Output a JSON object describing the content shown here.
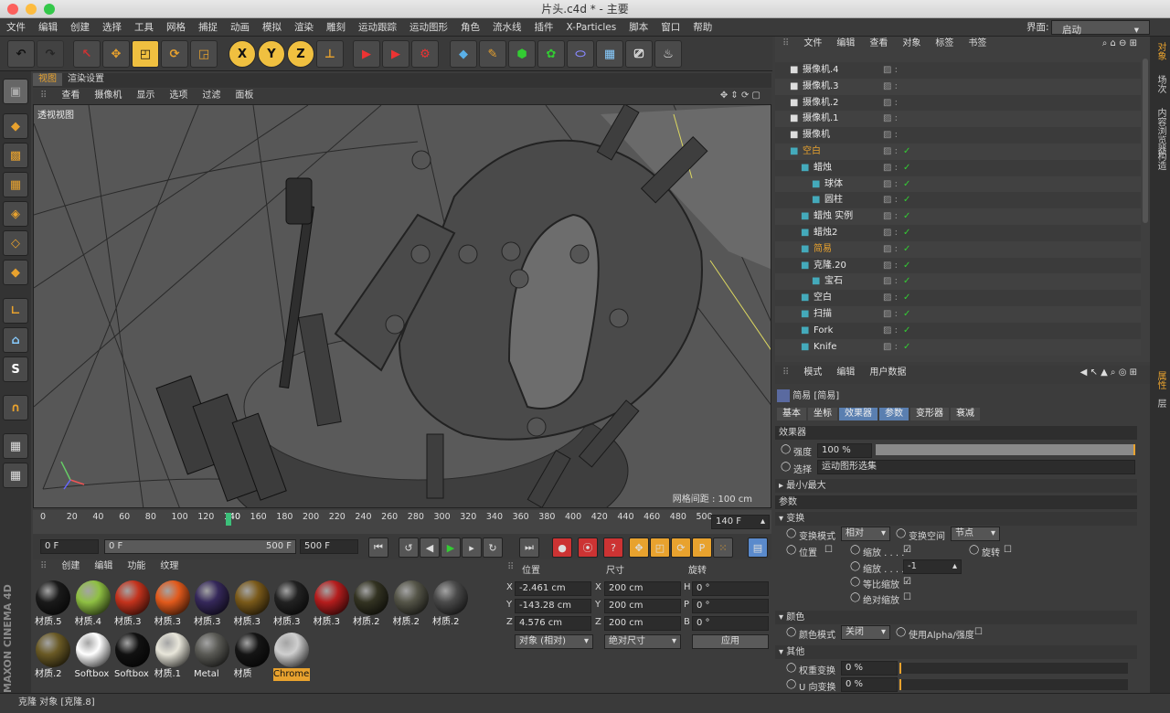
{
  "window": {
    "title": "片头.c4d * - 主要"
  },
  "menu": [
    "文件",
    "编辑",
    "创建",
    "选择",
    "工具",
    "网格",
    "捕捉",
    "动画",
    "模拟",
    "渲染",
    "雕刻",
    "运动跟踪",
    "运动图形",
    "角色",
    "流水线",
    "插件",
    "X-Particles",
    "脚本",
    "窗口",
    "帮助"
  ],
  "layout": {
    "label": "界面:",
    "value": "启动"
  },
  "toolbar": {
    "x": "X",
    "y": "Y",
    "z": "Z"
  },
  "viewport": {
    "tabs": [
      "视图",
      "渲染设置"
    ],
    "menu": [
      "查看",
      "摄像机",
      "显示",
      "选项",
      "过滤",
      "面板"
    ],
    "label": "透视视图",
    "grid": "网格间距 : 100 cm"
  },
  "timeline": {
    "ticks": [
      "0",
      "20",
      "40",
      "60",
      "80",
      "100",
      "120",
      "140",
      "160",
      "180",
      "200",
      "220",
      "240",
      "260",
      "280",
      "300",
      "320",
      "340",
      "360",
      "380",
      "400",
      "420",
      "440",
      "460",
      "480",
      "500"
    ],
    "current": "140",
    "frame_field": "140 F"
  },
  "playback": {
    "start": "0 F",
    "range_start": "0 F",
    "range_end": "500 F",
    "end": "500 F"
  },
  "materials": {
    "menu": [
      "创建",
      "编辑",
      "功能",
      "纹理"
    ],
    "items": [
      {
        "name": "材质.5",
        "color": "#1a1a1a"
      },
      {
        "name": "材质.4",
        "color": "#8fc043"
      },
      {
        "name": "材质.3",
        "color": "#c4331d"
      },
      {
        "name": "材质.3",
        "color": "#e25a1c"
      },
      {
        "name": "材质.3",
        "color": "#35285a"
      },
      {
        "name": "材质.3",
        "color": "#7a5a1a"
      },
      {
        "name": "材质.3",
        "color": "#222222"
      },
      {
        "name": "材质.3",
        "color": "#b51d1d"
      },
      {
        "name": "材质.2",
        "color": "#333322"
      },
      {
        "name": "材质.2",
        "color": "#555548"
      },
      {
        "name": "材质.2",
        "color": "#4a4a4a"
      },
      {
        "name": "材质.2",
        "color": "#6a5a25"
      },
      {
        "name": "Softbox",
        "color": "#ffffff"
      },
      {
        "name": "Softbox",
        "color": "#111111"
      },
      {
        "name": "材质.1",
        "color": "#e8e6da"
      },
      {
        "name": "Metal",
        "color": "#5a5a55"
      },
      {
        "name": "材质",
        "color": "#151515"
      },
      {
        "name": "Chrome",
        "color": "#cfcfcf"
      }
    ]
  },
  "coords": {
    "headers": [
      "位置",
      "尺寸",
      "旋转"
    ],
    "rows": [
      {
        "axis": "X",
        "pos": "-2.461 cm",
        "size_axis": "X",
        "size": "200 cm",
        "rot_axis": "H",
        "rot": "0 °"
      },
      {
        "axis": "Y",
        "pos": "-143.28 cm",
        "size_axis": "Y",
        "size": "200 cm",
        "rot_axis": "P",
        "rot": "0 °"
      },
      {
        "axis": "Z",
        "pos": "4.576 cm",
        "size_axis": "Z",
        "size": "200 cm",
        "rot_axis": "B",
        "rot": "0 °"
      }
    ],
    "mode": "对象 (相对)",
    "size_mode": "绝对尺寸",
    "apply": "应用"
  },
  "objects": {
    "menu": [
      "文件",
      "编辑",
      "查看",
      "对象",
      "标签",
      "书签"
    ],
    "rows": [
      {
        "name": "摄像机.4",
        "indent": 0
      },
      {
        "name": "摄像机.3",
        "indent": 0
      },
      {
        "name": "摄像机.2",
        "indent": 0
      },
      {
        "name": "摄像机.1",
        "indent": 0
      },
      {
        "name": "摄像机",
        "indent": 0
      },
      {
        "name": "空白",
        "indent": 0
      },
      {
        "name": "蜡烛",
        "indent": 1
      },
      {
        "name": "球体",
        "indent": 2
      },
      {
        "name": "圆柱",
        "indent": 2
      },
      {
        "name": "蜡烛 实例",
        "indent": 1
      },
      {
        "name": "蜡烛2",
        "indent": 1
      },
      {
        "name": "简易",
        "indent": 1
      },
      {
        "name": "克隆.20",
        "indent": 1
      },
      {
        "name": "宝石",
        "indent": 2
      },
      {
        "name": "空白",
        "indent": 1
      },
      {
        "name": "扫描",
        "indent": 1
      },
      {
        "name": "Fork",
        "indent": 1
      },
      {
        "name": "Knife",
        "indent": 1
      }
    ]
  },
  "attributes": {
    "menu": [
      "模式",
      "编辑",
      "用户数据"
    ],
    "object": "简易 [简易]",
    "tabs": [
      "基本",
      "坐标",
      "效果器",
      "参数",
      "变形器",
      "衰减"
    ],
    "effector": "效果器",
    "strength_label": "强度",
    "strength": "100 %",
    "selection_label": "选择",
    "selection": "运动图形选集",
    "minmax": "最小/最大",
    "params": "参数",
    "transform": "变换",
    "transform_mode_label": "变换模式",
    "transform_mode": "相对",
    "transform_space_label": "变换空间",
    "transform_space": "节点",
    "position": "位置",
    "scale": "缩放 . . . .",
    "rotation": "旋转",
    "scale2": "缩放 . . . .",
    "scale_value": "-1",
    "uniform": "等比缩放",
    "absolute": "绝对缩放",
    "color": "颜色",
    "color_mode_label": "颜色模式",
    "color_mode": "关闭",
    "use_alpha": "使用Alpha/强度",
    "other": "其他",
    "weight": "权重变换",
    "weight_val": "0 %",
    "u": "U 向变换",
    "u_val": "0 %",
    "v": "V 向变换",
    "v_val": "0 %"
  },
  "right_tabs": [
    "对象",
    "场次",
    "内容浏览器",
    "构造",
    "属性",
    "层"
  ],
  "status": "克隆 对象 [克隆.8]",
  "brand": "MAXON CINEMA 4D"
}
